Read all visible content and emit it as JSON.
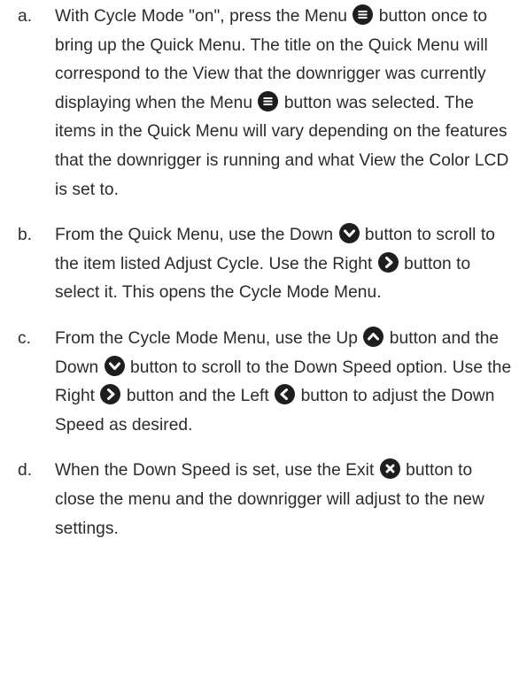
{
  "steps": [
    {
      "marker": "a.",
      "segments": [
        {
          "text": "With Cycle Mode \"on\", press the Menu "
        },
        {
          "icon": "menu-icon"
        },
        {
          "text": " button once to bring up the Quick Menu. The title on the Quick Menu will correspond to the View that the downrigger was currently displaying when the Menu "
        },
        {
          "icon": "menu-icon"
        },
        {
          "text": " button was selected. The items in the Quick Menu will vary depending on the features that the downrigger is running and what View the Color LCD is set to."
        }
      ]
    },
    {
      "marker": "b.",
      "segments": [
        {
          "text": "From the Quick Menu, use the Down "
        },
        {
          "icon": "down-arrow-icon"
        },
        {
          "text": " button to scroll to the item listed Adjust Cycle. Use the Right "
        },
        {
          "icon": "right-arrow-icon"
        },
        {
          "text": " button to select it. This opens the Cycle Mode Menu."
        }
      ]
    },
    {
      "marker": "c.",
      "segments": [
        {
          "text": "From the Cycle Mode Menu, use the Up "
        },
        {
          "icon": "up-arrow-icon"
        },
        {
          "text": " button and the Down "
        },
        {
          "icon": "down-arrow-icon"
        },
        {
          "text": " button to scroll to the Down Speed option. Use the Right "
        },
        {
          "icon": "right-arrow-icon"
        },
        {
          "text": " button and the Left "
        },
        {
          "icon": "left-arrow-icon"
        },
        {
          "text": " button to adjust the Down Speed as desired."
        }
      ]
    },
    {
      "marker": "d.",
      "segments": [
        {
          "text": "When the Down Speed is set, use the Exit "
        },
        {
          "icon": "exit-icon"
        },
        {
          "text": " button to close the menu and the downrigger will adjust to the new settings."
        }
      ]
    }
  ]
}
